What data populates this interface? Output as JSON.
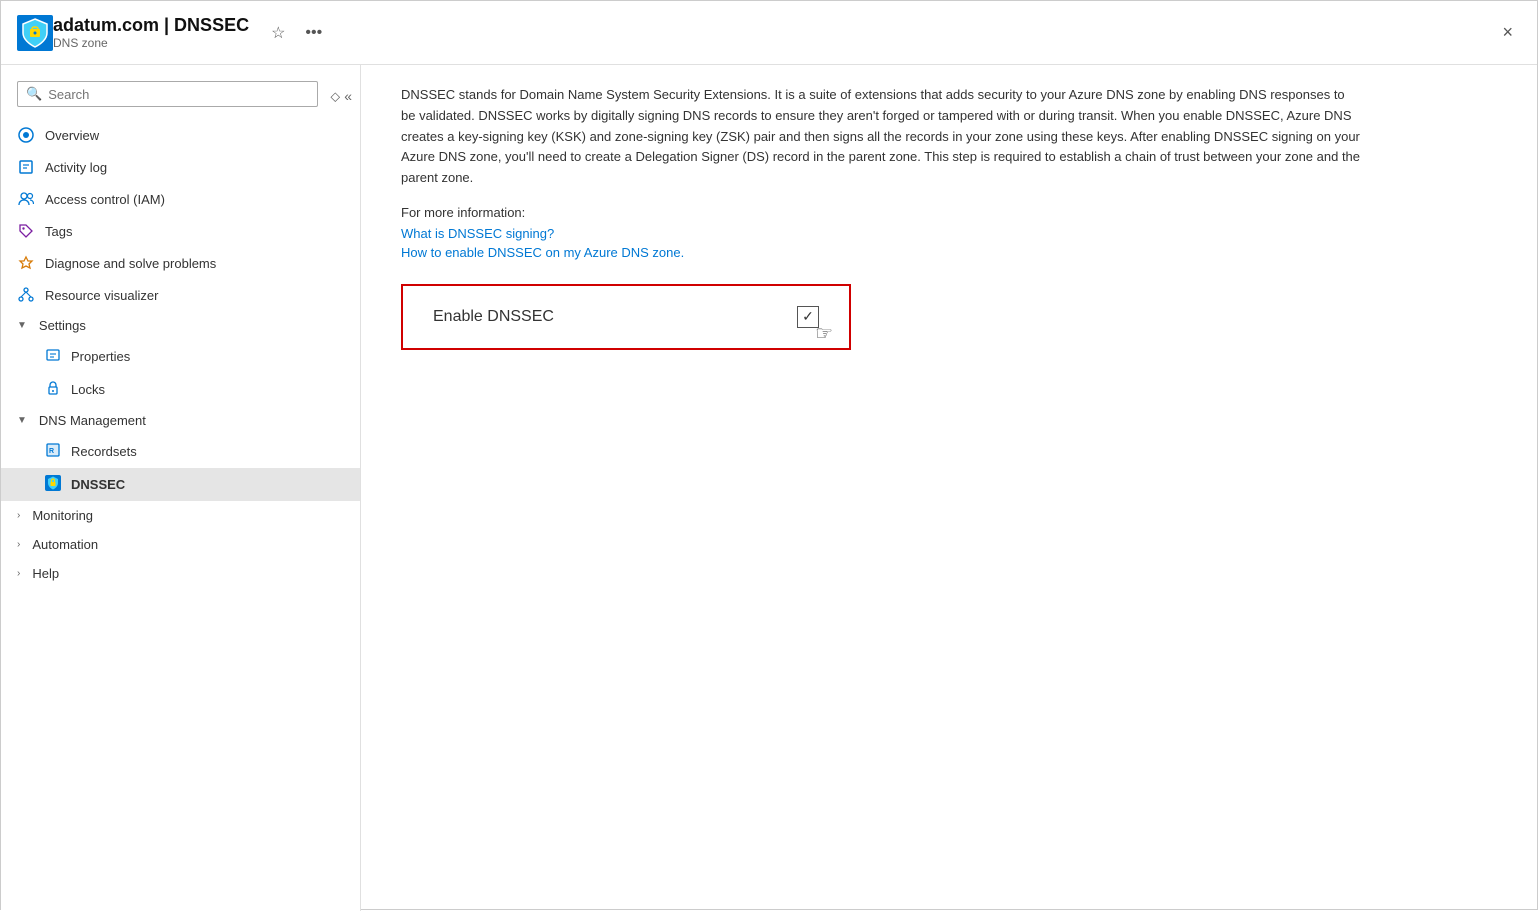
{
  "header": {
    "title": "adatum.com | DNSSEC",
    "subtitle": "DNS zone",
    "favorite_label": "★",
    "more_label": "•••",
    "close_label": "×",
    "separator": "|"
  },
  "sidebar": {
    "search_placeholder": "Search",
    "items": [
      {
        "id": "overview",
        "label": "Overview",
        "icon": "overview"
      },
      {
        "id": "activity-log",
        "label": "Activity log",
        "icon": "activity"
      },
      {
        "id": "access-control",
        "label": "Access control (IAM)",
        "icon": "iam"
      },
      {
        "id": "tags",
        "label": "Tags",
        "icon": "tags"
      },
      {
        "id": "diagnose",
        "label": "Diagnose and solve problems",
        "icon": "diagnose"
      },
      {
        "id": "resource-visualizer",
        "label": "Resource visualizer",
        "icon": "visualizer"
      }
    ],
    "sections": [
      {
        "id": "settings",
        "label": "Settings",
        "expanded": true,
        "children": [
          {
            "id": "properties",
            "label": "Properties",
            "icon": "properties"
          },
          {
            "id": "locks",
            "label": "Locks",
            "icon": "locks"
          }
        ]
      },
      {
        "id": "dns-management",
        "label": "DNS Management",
        "expanded": true,
        "children": [
          {
            "id": "recordsets",
            "label": "Recordsets",
            "icon": "recordsets"
          },
          {
            "id": "dnssec",
            "label": "DNSSEC",
            "icon": "dnssec",
            "active": true
          }
        ]
      },
      {
        "id": "monitoring",
        "label": "Monitoring",
        "expanded": false,
        "children": []
      },
      {
        "id": "automation",
        "label": "Automation",
        "expanded": false,
        "children": []
      },
      {
        "id": "help",
        "label": "Help",
        "expanded": false,
        "children": []
      }
    ]
  },
  "content": {
    "description": "DNSSEC stands for Domain Name System Security Extensions. It is a suite of extensions that adds security to your Azure DNS zone by enabling DNS responses to be validated. DNSSEC works by digitally signing DNS records to ensure they aren't forged or tampered with or during transit. When you enable DNSSEC, Azure DNS creates a key-signing key (KSK) and zone-signing key (ZSK) pair and then signs all the records in your zone using these keys. After enabling DNSSEC signing on your Azure DNS zone, you'll need to create a Delegation Signer (DS) record in the parent zone. This step is required to establish a chain of trust between your zone and the parent zone.",
    "more_info_label": "For more information:",
    "links": [
      {
        "id": "what-is-dnssec",
        "label": "What is DNSSEC signing?"
      },
      {
        "id": "how-to-enable",
        "label": "How to enable DNSSEC on my Azure DNS zone."
      }
    ],
    "enable_card": {
      "label": "Enable DNSSEC",
      "checkbox_check": "✓"
    }
  }
}
